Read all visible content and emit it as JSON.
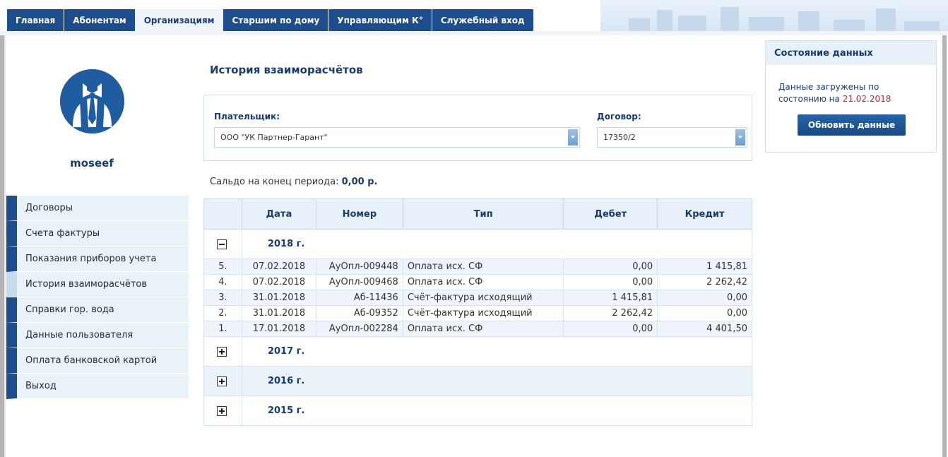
{
  "nav": {
    "tabs": [
      {
        "label": "Главная"
      },
      {
        "label": "Абонентам"
      },
      {
        "label": "Организациям"
      },
      {
        "label": "Старшим по дому"
      },
      {
        "label": "Управляющим К°"
      },
      {
        "label": "Служебный вход"
      }
    ],
    "active_index": 2
  },
  "profile": {
    "avatar_icon": "business-suit-icon",
    "username": "moseef"
  },
  "sidebar": {
    "items": [
      {
        "label": "Договоры"
      },
      {
        "label": "Счета фактуры"
      },
      {
        "label": "Показания приборов учета"
      },
      {
        "label": "История взаиморасчётов"
      },
      {
        "label": "Справки гор. вода"
      },
      {
        "label": "Данные пользователя"
      },
      {
        "label": "Оплата банковской картой"
      },
      {
        "label": "Выход"
      }
    ],
    "active_index": 3
  },
  "main": {
    "title": "История взаиморасчётов",
    "payer_label": "Плательщик:",
    "payer_value": "ООО \"УК Партнер-Гарант\"",
    "contract_label": "Договор:",
    "contract_value": "17350/2",
    "saldo_label": "Сальдо на конец периода:",
    "saldo_value": "0,00 р."
  },
  "table": {
    "headers": [
      "",
      "Дата",
      "Номер",
      "Тип",
      "Дебет",
      "Кредит"
    ],
    "years": [
      {
        "label": "2018 г.",
        "expanded": true,
        "rows": [
          {
            "num": "5.",
            "date": "07.02.2018",
            "number": "АуОпл-009448",
            "type": "Оплата исх. СФ",
            "debit": "0,00",
            "credit": "1 415,81"
          },
          {
            "num": "4.",
            "date": "07.02.2018",
            "number": "АуОпл-009468",
            "type": "Оплата исх. СФ",
            "debit": "0,00",
            "credit": "2 262,42"
          },
          {
            "num": "3.",
            "date": "31.01.2018",
            "number": "Аб-11436",
            "type": "Счёт-фактура исходящий",
            "debit": "1 415,81",
            "credit": "0,00"
          },
          {
            "num": "2.",
            "date": "31.01.2018",
            "number": "Аб-09352",
            "type": "Счёт-фактура исходящий",
            "debit": "2 262,42",
            "credit": "0,00"
          },
          {
            "num": "1.",
            "date": "17.01.2018",
            "number": "АуОпл-002284",
            "type": "Оплата исх. СФ",
            "debit": "0,00",
            "credit": "4 401,50"
          }
        ]
      },
      {
        "label": "2017 г.",
        "expanded": false
      },
      {
        "label": "2016 г.",
        "expanded": false
      },
      {
        "label": "2015 г.",
        "expanded": false
      }
    ]
  },
  "data_panel": {
    "title": "Состояние данных",
    "text": "Данные загружены по состоянию на",
    "date": "21.02.2018",
    "button_label": "Обновить данные"
  },
  "colors": {
    "nav_blue": "#1c4e8f",
    "panel_bg": "#e8f1fa",
    "date_red": "#c1272d"
  }
}
